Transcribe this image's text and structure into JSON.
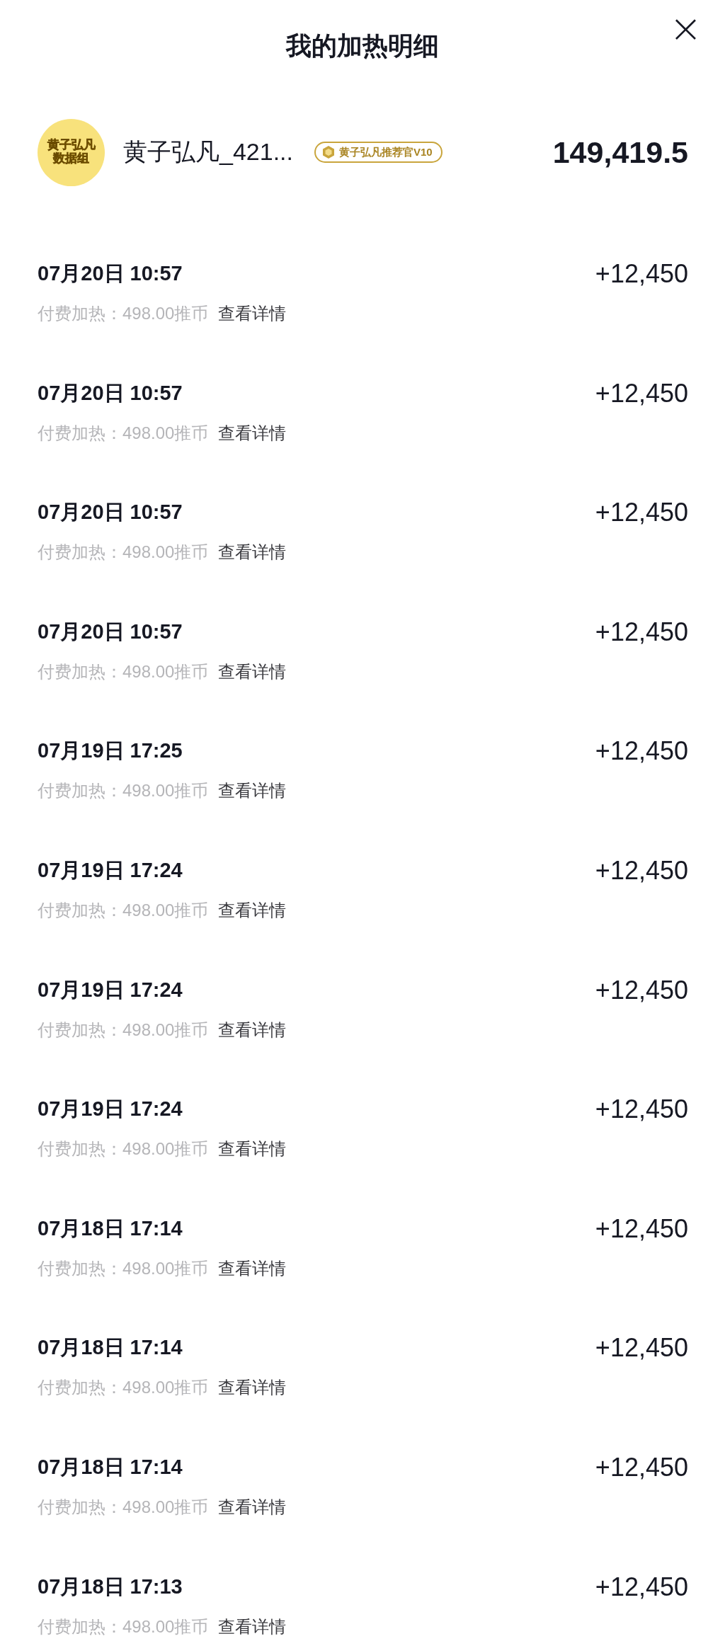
{
  "header": {
    "title": "我的加热明细",
    "close": "×"
  },
  "profile": {
    "avatar_lines": [
      "黄子弘凡",
      "数据组"
    ],
    "name": "黄子弘凡_421...",
    "badge": "黄子弘凡推荐官V10",
    "total": "149,419.5"
  },
  "records": [
    {
      "time": "07月20日 10:57",
      "amount": "+12,450",
      "detail": "付费加热：498.00推币",
      "link": "查看详情"
    },
    {
      "time": "07月20日 10:57",
      "amount": "+12,450",
      "detail": "付费加热：498.00推币",
      "link": "查看详情"
    },
    {
      "time": "07月20日 10:57",
      "amount": "+12,450",
      "detail": "付费加热：498.00推币",
      "link": "查看详情"
    },
    {
      "time": "07月20日 10:57",
      "amount": "+12,450",
      "detail": "付费加热：498.00推币",
      "link": "查看详情"
    },
    {
      "time": "07月19日 17:25",
      "amount": "+12,450",
      "detail": "付费加热：498.00推币",
      "link": "查看详情"
    },
    {
      "time": "07月19日 17:24",
      "amount": "+12,450",
      "detail": "付费加热：498.00推币",
      "link": "查看详情"
    },
    {
      "time": "07月19日 17:24",
      "amount": "+12,450",
      "detail": "付费加热：498.00推币",
      "link": "查看详情"
    },
    {
      "time": "07月19日 17:24",
      "amount": "+12,450",
      "detail": "付费加热：498.00推币",
      "link": "查看详情"
    },
    {
      "time": "07月18日 17:14",
      "amount": "+12,450",
      "detail": "付费加热：498.00推币",
      "link": "查看详情"
    },
    {
      "time": "07月18日 17:14",
      "amount": "+12,450",
      "detail": "付费加热：498.00推币",
      "link": "查看详情"
    },
    {
      "time": "07月18日 17:14",
      "amount": "+12,450",
      "detail": "付费加热：498.00推币",
      "link": "查看详情"
    },
    {
      "time": "07月18日 17:13",
      "amount": "+12,450",
      "detail": "付费加热：498.00推币",
      "link": "查看详情"
    }
  ]
}
